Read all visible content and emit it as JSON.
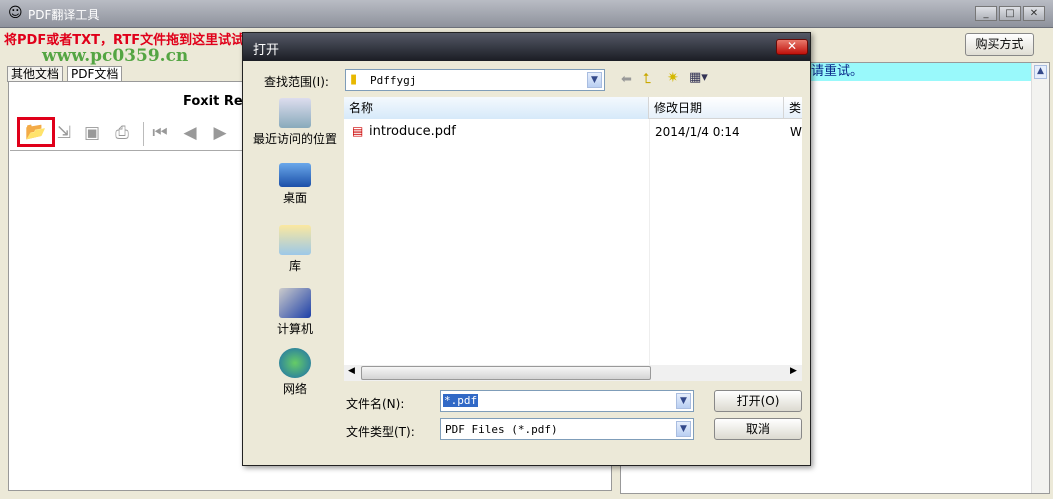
{
  "app": {
    "title": "PDF翻译工具",
    "banner": "将PDF或者TXT，RTF文件拖到这里试试    拖动窗口调整操作    ...",
    "watermark": "www.pc0359.cn",
    "buy_label": "购买方式",
    "status_text": "请重试。"
  },
  "tabs": [
    {
      "label": "其他文档"
    },
    {
      "label": "PDF文档"
    }
  ],
  "viewer": {
    "title": "Foxit Rea"
  },
  "toolbar": {
    "icons": [
      "open-folder-icon",
      "import-icon",
      "save-icon",
      "print-icon",
      "first-page-icon",
      "prev-page-icon",
      "next-page-icon"
    ]
  },
  "dialog": {
    "title": "打开",
    "look_in_label": "查找范围(I):",
    "look_in_value": "Pdffygj",
    "places": [
      {
        "label": "最近访问的位置"
      },
      {
        "label": "桌面"
      },
      {
        "label": "库"
      },
      {
        "label": "计算机"
      },
      {
        "label": "网络"
      }
    ],
    "columns": [
      "名称",
      "修改日期",
      "类"
    ],
    "files": [
      {
        "name": "introduce.pdf",
        "date": "2014/1/4 0:14",
        "type": "W"
      }
    ],
    "filename_label": "文件名(N):",
    "filename_value": "*.pdf",
    "filetype_label": "文件类型(T):",
    "filetype_value": "PDF Files (*.pdf)",
    "open_label": "打开(O)",
    "cancel_label": "取消"
  },
  "colors": {
    "banner": "#e0001a",
    "status_bg": "#99f9fb",
    "highlight": "#ff0000"
  }
}
